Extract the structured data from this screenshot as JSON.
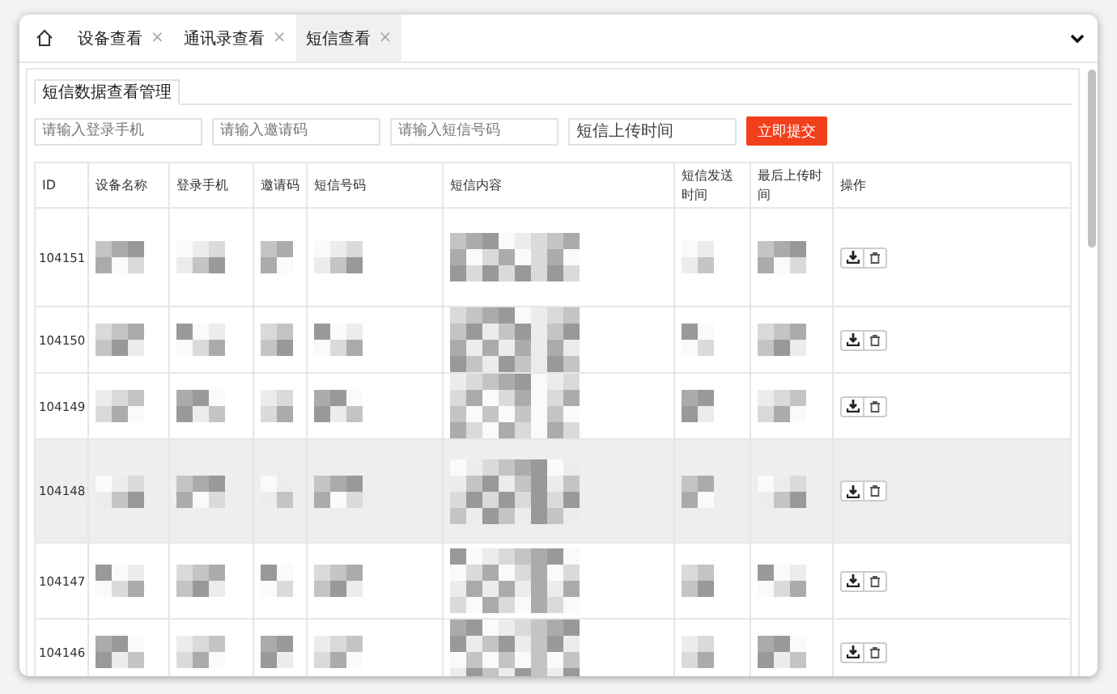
{
  "tabs": [
    {
      "label": "设备查看",
      "close": "×",
      "selected": false
    },
    {
      "label": "通讯录查看",
      "close": "×",
      "selected": false
    },
    {
      "label": "短信查看",
      "close": "×",
      "selected": true
    }
  ],
  "panel": {
    "title": "短信数据查看管理"
  },
  "filters": [
    {
      "kind": "text",
      "placeholder": "请输入登录手机"
    },
    {
      "kind": "text",
      "placeholder": "请输入邀请码"
    },
    {
      "kind": "text",
      "placeholder": "请输入短信号码"
    },
    {
      "kind": "date",
      "placeholder": "短信上传时间"
    }
  ],
  "submit_button": "立即提交",
  "table": {
    "masked": true,
    "columns": [
      "ID",
      "设备名称",
      "登录手机",
      "邀请码",
      "短信号码",
      "短信内容",
      "短信发送时间",
      "最后上传时间",
      "操作"
    ],
    "rows": [
      {
        "id": "104151",
        "selected": false
      },
      {
        "id": "104150",
        "selected": false
      },
      {
        "id": "104149",
        "selected": false
      },
      {
        "id": "104148",
        "selected": true
      },
      {
        "id": "104147",
        "selected": false
      },
      {
        "id": "104146",
        "selected": false
      }
    ]
  }
}
